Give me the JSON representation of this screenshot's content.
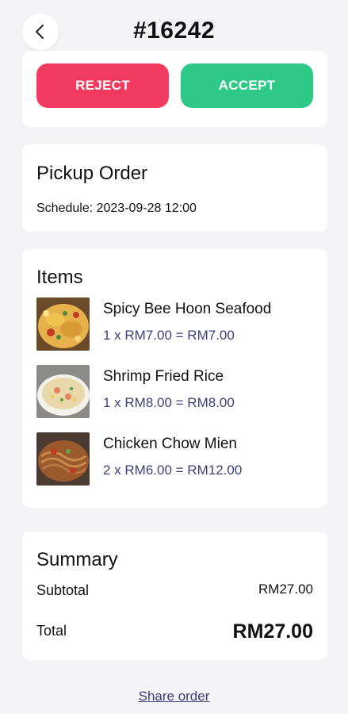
{
  "header": {
    "back_icon": "chevron-left-icon",
    "title": "#16242"
  },
  "actions": {
    "reject_label": "REJECT",
    "accept_label": "ACCEPT",
    "reject_color": "#f23a61",
    "accept_color": "#2ec987"
  },
  "pickup": {
    "title": "Pickup Order",
    "schedule": "Schedule: 2023-09-28 12:00"
  },
  "items": {
    "title": "Items",
    "list": [
      {
        "name": "Spicy Bee Hoon Seafood",
        "price_line": "1 x RM7.00 = RM7.00"
      },
      {
        "name": "Shrimp Fried Rice",
        "price_line": "1 x RM8.00 = RM8.00"
      },
      {
        "name": "Chicken Chow Mien",
        "price_line": "2 x RM6.00 = RM12.00"
      }
    ]
  },
  "summary": {
    "title": "Summary",
    "subtotal_label": "Subtotal",
    "subtotal_value": "RM27.00",
    "total_label": "Total",
    "total_value": "RM27.00"
  },
  "footer": {
    "share_label": "Share order"
  }
}
